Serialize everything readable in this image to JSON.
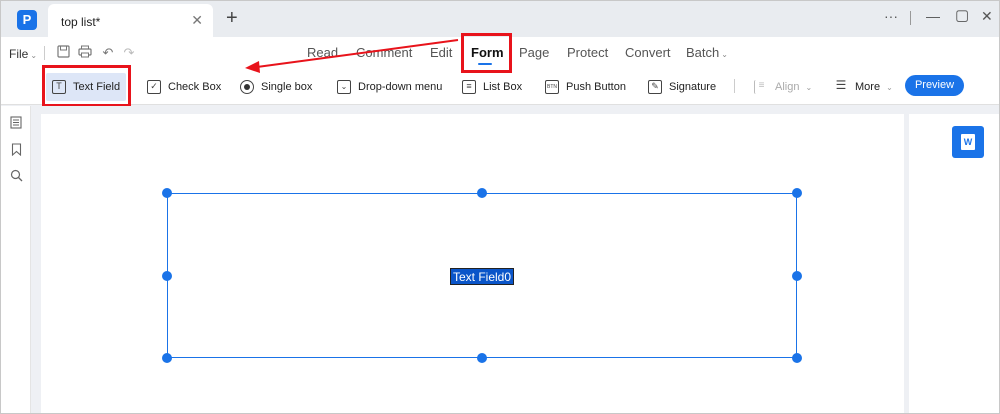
{
  "titlebar": {
    "tab_title": "top list*",
    "close_glyph": "✕",
    "new_tab_glyph": "+",
    "more_glyph": "···",
    "minimize_glyph": "—",
    "maximize_glyph": "▢",
    "close_window_glyph": "✕"
  },
  "menu": {
    "file_label": "File",
    "tabs": [
      {
        "label": "Read"
      },
      {
        "label": "Comment"
      },
      {
        "label": "Edit"
      },
      {
        "label": "Form"
      },
      {
        "label": "Page"
      },
      {
        "label": "Protect"
      },
      {
        "label": "Convert"
      },
      {
        "label": "Batch"
      }
    ],
    "active_tab": "Form"
  },
  "toolbar": {
    "text_field": "Text Field",
    "check_box": "Check Box",
    "single_box": "Single box",
    "dropdown_menu": "Drop-down menu",
    "list_box": "List Box",
    "push_button": "Push Button",
    "signature": "Signature",
    "align": "Align",
    "more": "More",
    "preview": "Preview"
  },
  "document": {
    "field_label": "Text Field0"
  },
  "colors": {
    "accent": "#1a73e8",
    "highlight": "#e8131b"
  }
}
